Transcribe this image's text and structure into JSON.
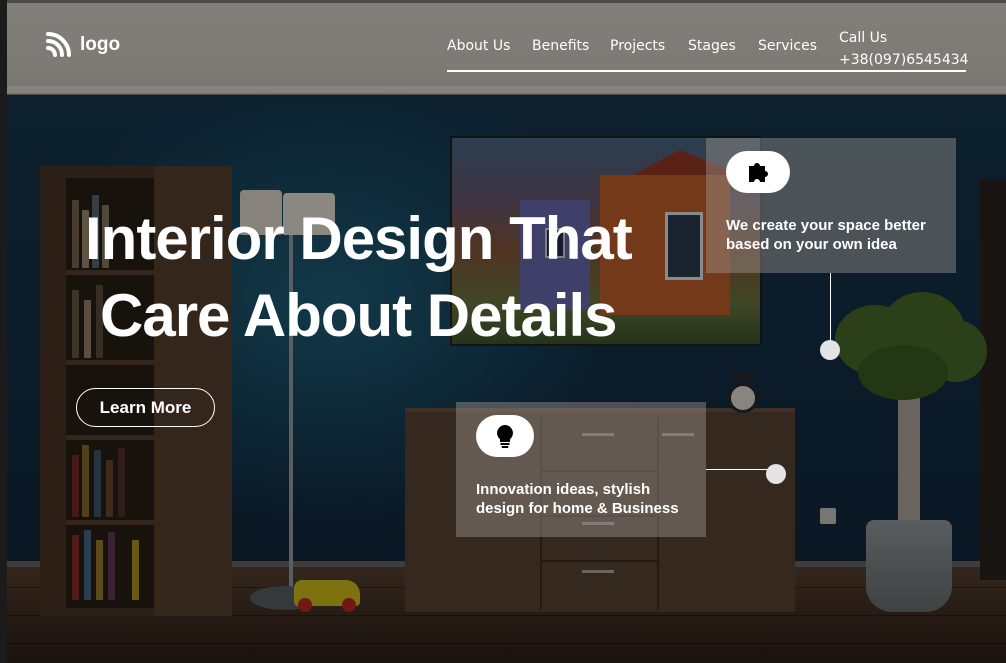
{
  "header": {
    "logo_text": "logo",
    "nav": [
      {
        "label": "About Us"
      },
      {
        "label": "Benefits"
      },
      {
        "label": "Projects"
      },
      {
        "label": "Stages"
      },
      {
        "label": "Services"
      }
    ],
    "call_label": "Call Us",
    "phone": "+38(097)6545434"
  },
  "hero": {
    "title_line1": "Interior Design That",
    "title_line2": "Care About Details",
    "cta_label": "Learn More"
  },
  "cards": [
    {
      "icon": "puzzle-icon",
      "text_line1": "We create your space better",
      "text_line2": "based on your own idea"
    },
    {
      "icon": "lightbulb-icon",
      "text_line1": "Innovation ideas, stylish",
      "text_line2": "design for home & Business"
    }
  ],
  "colors": {
    "text": "#ffffff",
    "header_bg": "rgba(150,145,140,0.55)",
    "card_bg": "rgba(165,158,150,0.42)",
    "icon_pill": "#ffffff",
    "marker_dot": "#e4e4e4"
  }
}
